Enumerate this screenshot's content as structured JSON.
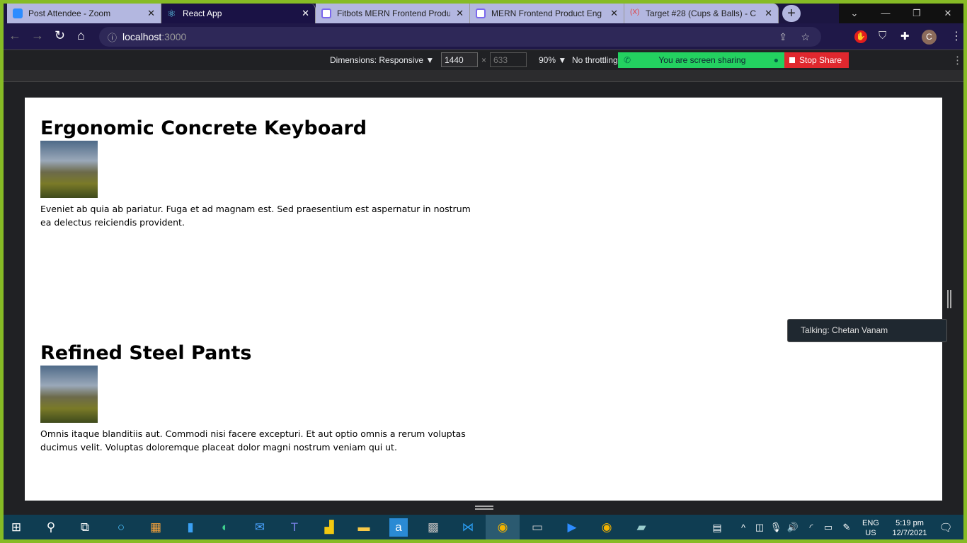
{
  "tabs": [
    {
      "title": "Post Attendee - Zoom",
      "color": "#2d8cff"
    },
    {
      "title": "React App",
      "color": "#61dafb"
    },
    {
      "title": "Fitbots MERN Frontend Product",
      "color": "#7b68ee"
    },
    {
      "title": "MERN Frontend Product Eng",
      "color": "#7b68ee"
    },
    {
      "title": "Target #28 (Cups & Balls) - C",
      "color": "#e04040"
    }
  ],
  "url": {
    "host": "localhost",
    "port": ":3000"
  },
  "devtools": {
    "dimensions": "Dimensions: Responsive ▼",
    "width": "1440",
    "height": "633",
    "zoom": "90% ▼",
    "throttling": "No throttling"
  },
  "share": {
    "status": "You are screen sharing",
    "stop": "Stop Share"
  },
  "talking": "Talking: Chetan Vanam",
  "avatar": "C",
  "products": [
    {
      "name": "Ergonomic Concrete Keyboard",
      "description": "Eveniet ab quia ab pariatur. Fuga et ad magnam est. Sed praesentium est aspernatur in nostrum ea delectus reiciendis provident."
    },
    {
      "name": "Refined Steel Pants",
      "description": "Omnis itaque blanditiis aut. Commodi nisi facere excepturi. Et aut optio omnis a rerum voluptas ducimus velit. Voluptas doloremque placeat dolor magni nostrum veniam qui ut."
    }
  ],
  "tray": {
    "lang": "ENG",
    "region": "US",
    "time": "5:19 pm",
    "date": "12/7/2021"
  }
}
